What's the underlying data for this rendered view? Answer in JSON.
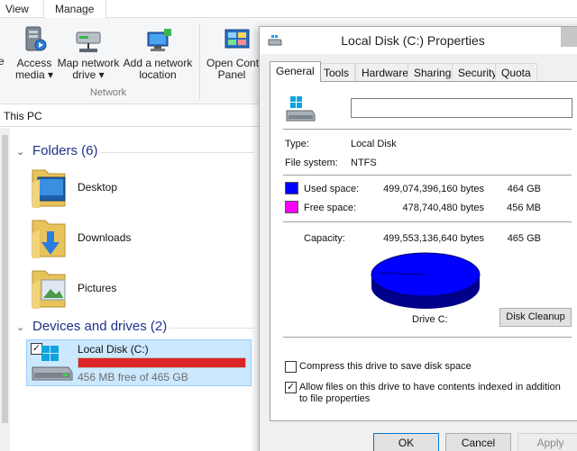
{
  "ribbon": {
    "tabs": [
      "View",
      "Manage"
    ],
    "buttons": [
      {
        "label1": "Access",
        "label2": "media ▾",
        "icon": "media-server-icon"
      },
      {
        "label1": "Map network",
        "label2": "drive ▾",
        "icon": "map-network-drive-icon"
      },
      {
        "label1": "Add a network",
        "label2": "location",
        "icon": "add-network-location-icon"
      },
      {
        "label1": "Open Cont",
        "label2": "Panel",
        "icon": "control-panel-icon"
      }
    ],
    "group_label": "Network",
    "left_cut_label": "e"
  },
  "address": {
    "path": "This PC"
  },
  "folders": {
    "header": "Folders (6)",
    "items": [
      {
        "name": "Desktop",
        "icon": "desktop-folder-icon"
      },
      {
        "name": "Downloads",
        "icon": "downloads-folder-icon"
      },
      {
        "name": "Pictures",
        "icon": "pictures-folder-icon"
      }
    ]
  },
  "devices": {
    "header": "Devices and drives (2)",
    "drive": {
      "name": "Local Disk (C:)",
      "free_text": "456 MB free of 465 GB",
      "used_fraction": 0.999,
      "bar_color": "#da2626"
    }
  },
  "dialog": {
    "title": "Local Disk (C:) Properties",
    "tabs": [
      "General",
      "Tools",
      "Hardware",
      "Sharing",
      "Security",
      "Quota"
    ],
    "volume_name": "",
    "type_label": "Type:",
    "type_value": "Local Disk",
    "fs_label": "File system:",
    "fs_value": "NTFS",
    "used_label": "Used space:",
    "used_bytes": "499,074,396,160 bytes",
    "used_size": "464 GB",
    "used_color": "#0000ff",
    "free_label": "Free space:",
    "free_bytes": "478,740,480 bytes",
    "free_size": "456 MB",
    "free_color": "#ff00ff",
    "capacity_label": "Capacity:",
    "capacity_bytes": "499,553,136,640 bytes",
    "capacity_size": "465 GB",
    "drive_label": "Drive C:",
    "cleanup_label": "Disk Cleanup",
    "compress_label": "Compress this drive to save disk space",
    "compress_checked": false,
    "index_label": "Allow files on this drive to have contents indexed in addition to file properties",
    "index_checked": true,
    "ok_label": "OK",
    "cancel_label": "Cancel",
    "apply_label": "Apply"
  }
}
